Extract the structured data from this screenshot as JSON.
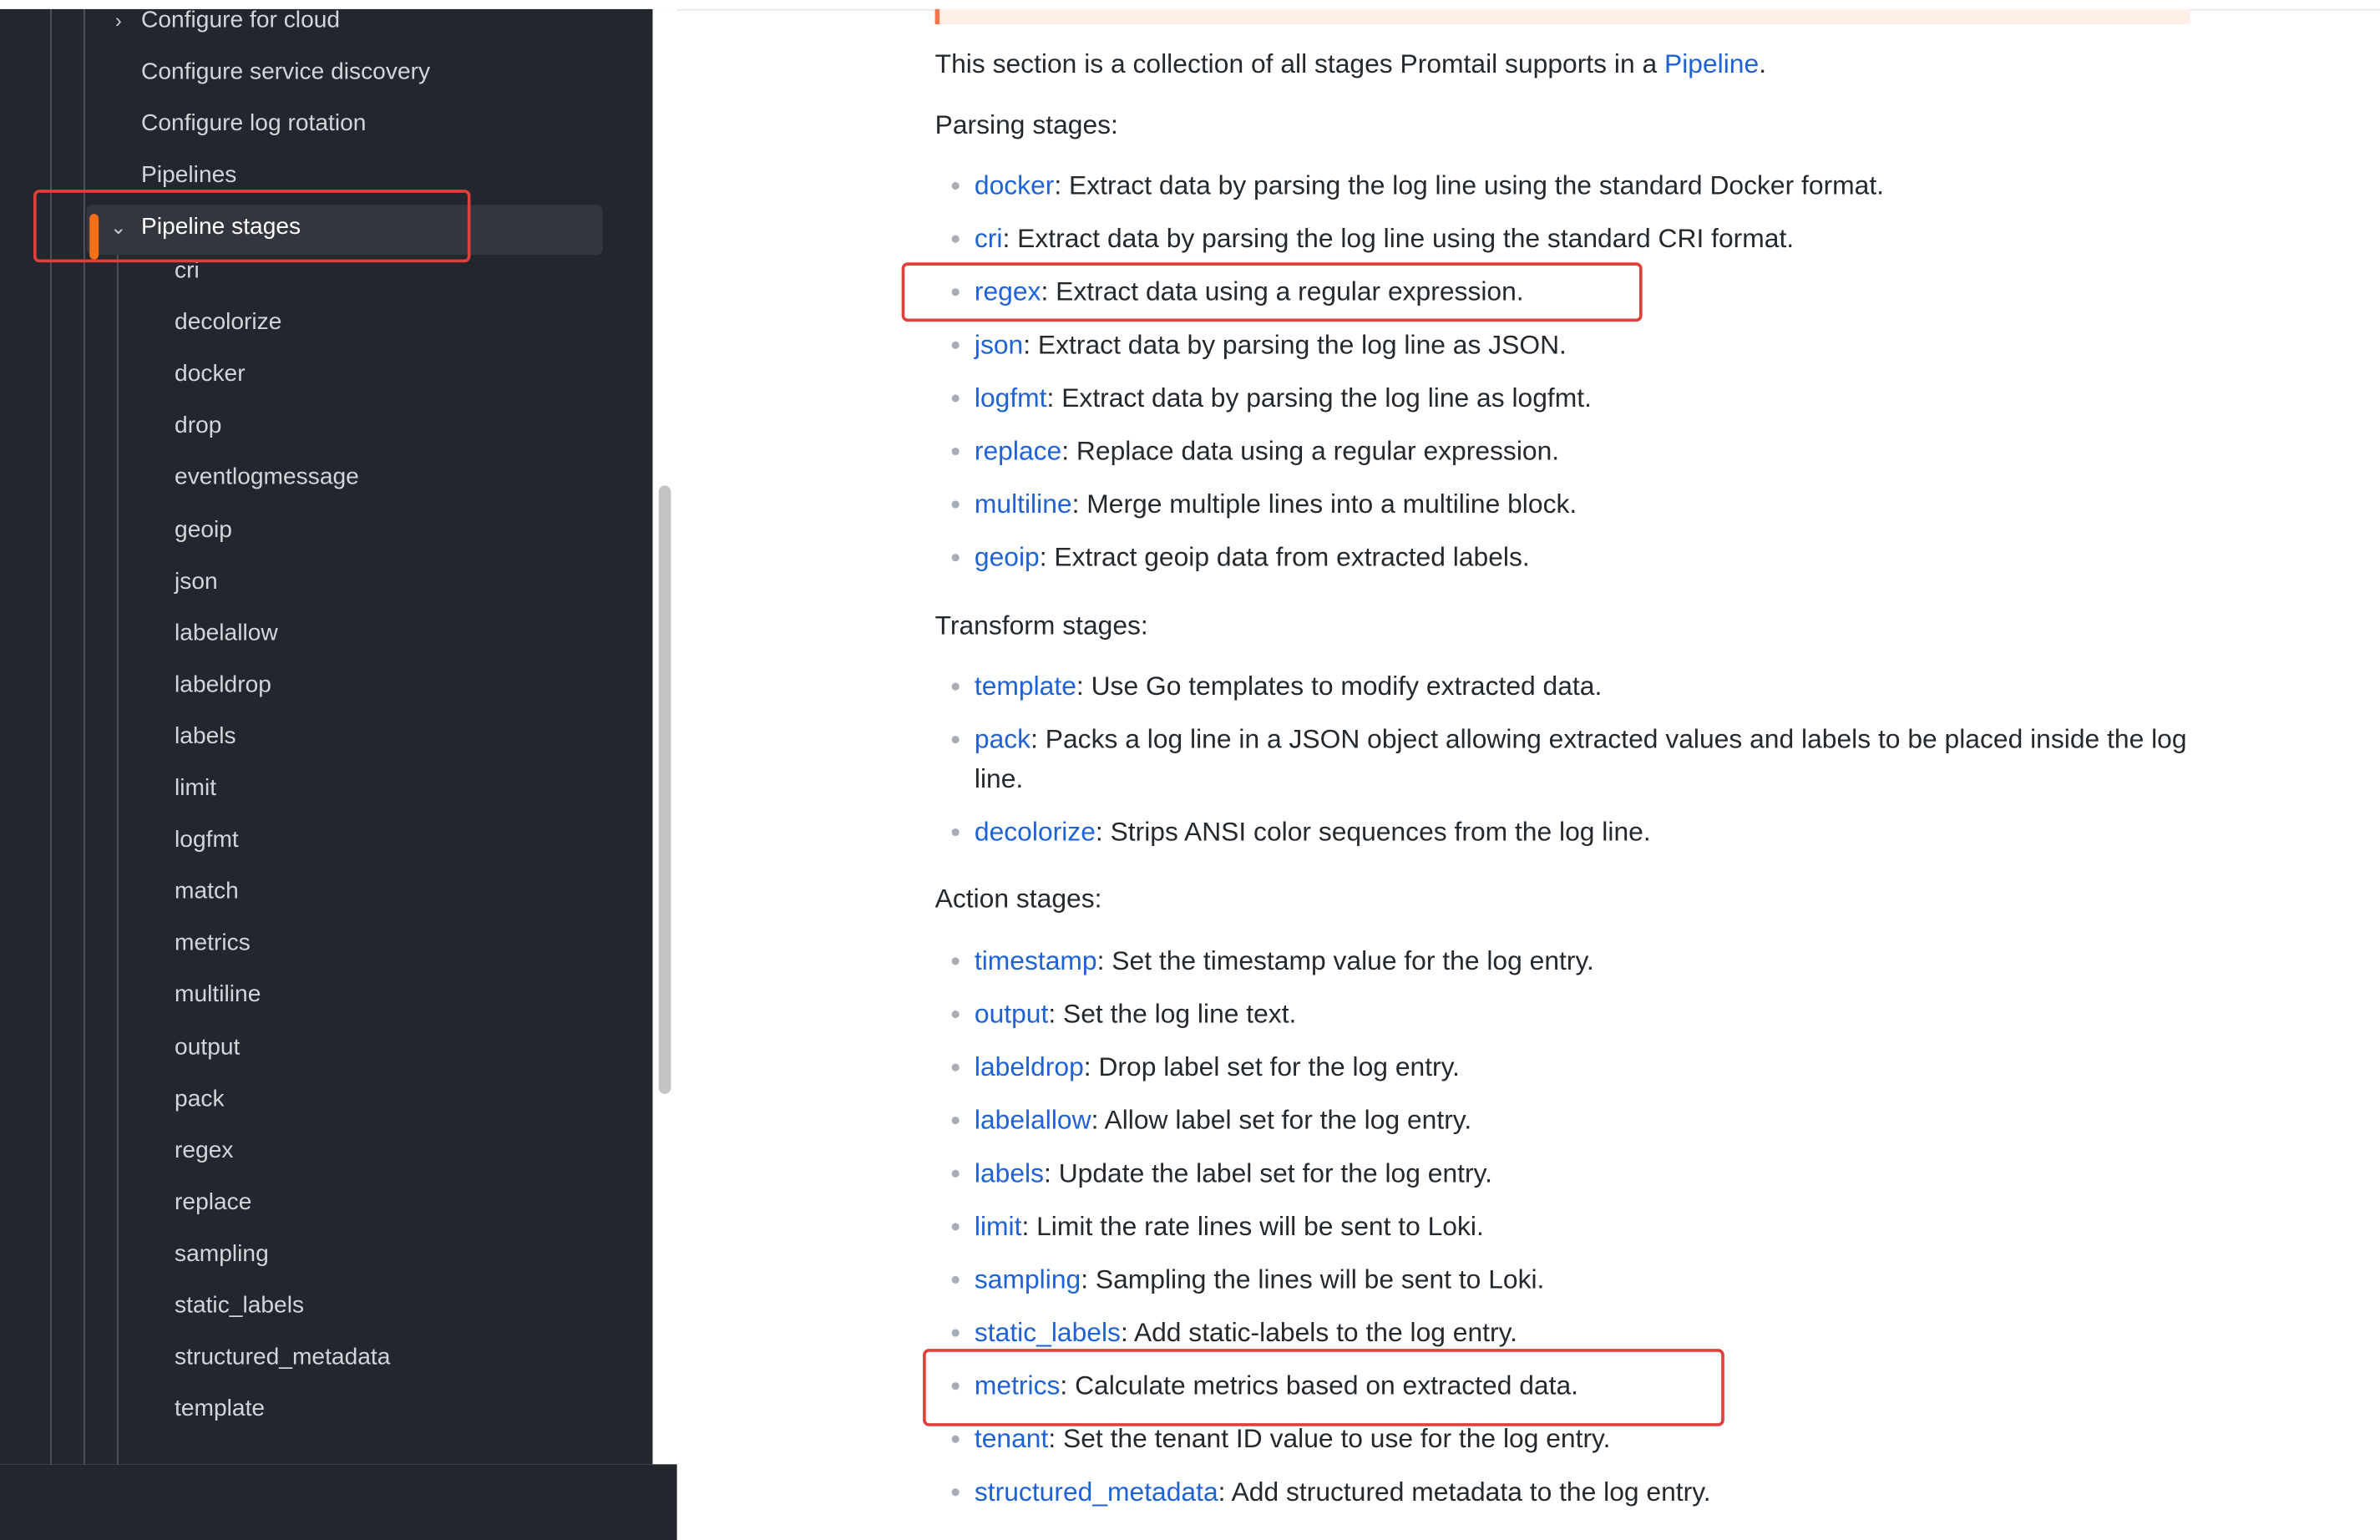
{
  "sidebar": {
    "top_items": [
      {
        "label": "Configure for cloud",
        "chevron": "›"
      },
      {
        "label": "Configure service discovery"
      },
      {
        "label": "Configure log rotation"
      },
      {
        "label": "Pipelines"
      },
      {
        "label": "Pipeline stages",
        "chevron": "⌄",
        "active": true
      }
    ],
    "sub_items": [
      "cri",
      "decolorize",
      "docker",
      "drop",
      "eventlogmessage",
      "geoip",
      "json",
      "labelallow",
      "labeldrop",
      "labels",
      "limit",
      "logfmt",
      "match",
      "metrics",
      "multiline",
      "output",
      "pack",
      "regex",
      "replace",
      "sampling",
      "static_labels",
      "structured_metadata",
      "template"
    ]
  },
  "content": {
    "intro": {
      "text": "This section is a collection of all stages Promtail supports in a ",
      "link": "Pipeline",
      "tail": "."
    },
    "sections": [
      {
        "heading": "Parsing stages:",
        "items": [
          {
            "link": "docker",
            "text": ": Extract data by parsing the log line using the standard Docker format."
          },
          {
            "link": "cri",
            "text": ": Extract data by parsing the log line using the standard CRI format."
          },
          {
            "link": "regex",
            "text": ": Extract data using a regular expression."
          },
          {
            "link": "json",
            "text": ": Extract data by parsing the log line as JSON."
          },
          {
            "link": "logfmt",
            "text": ": Extract data by parsing the log line as logfmt."
          },
          {
            "link": "replace",
            "text": ": Replace data using a regular expression."
          },
          {
            "link": "multiline",
            "text": ": Merge multiple lines into a multiline block."
          },
          {
            "link": "geoip",
            "text": ": Extract geoip data from extracted labels."
          }
        ]
      },
      {
        "heading": "Transform stages:",
        "items": [
          {
            "link": "template",
            "text": ": Use Go templates to modify extracted data."
          },
          {
            "link": "pack",
            "text": ": Packs a log line in a JSON object allowing extracted values and labels to be placed inside the log line."
          },
          {
            "link": "decolorize",
            "text": ": Strips ANSI color sequences from the log line."
          }
        ]
      },
      {
        "heading": "Action stages:",
        "items": [
          {
            "link": "timestamp",
            "text": ": Set the timestamp value for the log entry."
          },
          {
            "link": "output",
            "text": ": Set the log line text."
          },
          {
            "link": "labeldrop",
            "text": ": Drop label set for the log entry."
          },
          {
            "link": "labelallow",
            "text": ": Allow label set for the log entry."
          },
          {
            "link": "labels",
            "text": ": Update the label set for the log entry."
          },
          {
            "link": "limit",
            "text": ": Limit the rate lines will be sent to Loki."
          },
          {
            "link": "sampling",
            "text": ": Sampling the lines will be sent to Loki."
          },
          {
            "link": "static_labels",
            "text": ": Add static-labels to the log entry."
          },
          {
            "link": "metrics",
            "text": ": Calculate metrics based on extracted data."
          },
          {
            "link": "tenant",
            "text": ": Set the tenant ID value to use for the log entry."
          },
          {
            "link": "structured_metadata",
            "text": ": Add structured metadata to the log entry."
          }
        ]
      }
    ]
  },
  "colors": {
    "sidebar_bg": "#23262d",
    "accent": "#f46f17",
    "link": "#1f62d6",
    "highlight_box": "#e0403a"
  }
}
